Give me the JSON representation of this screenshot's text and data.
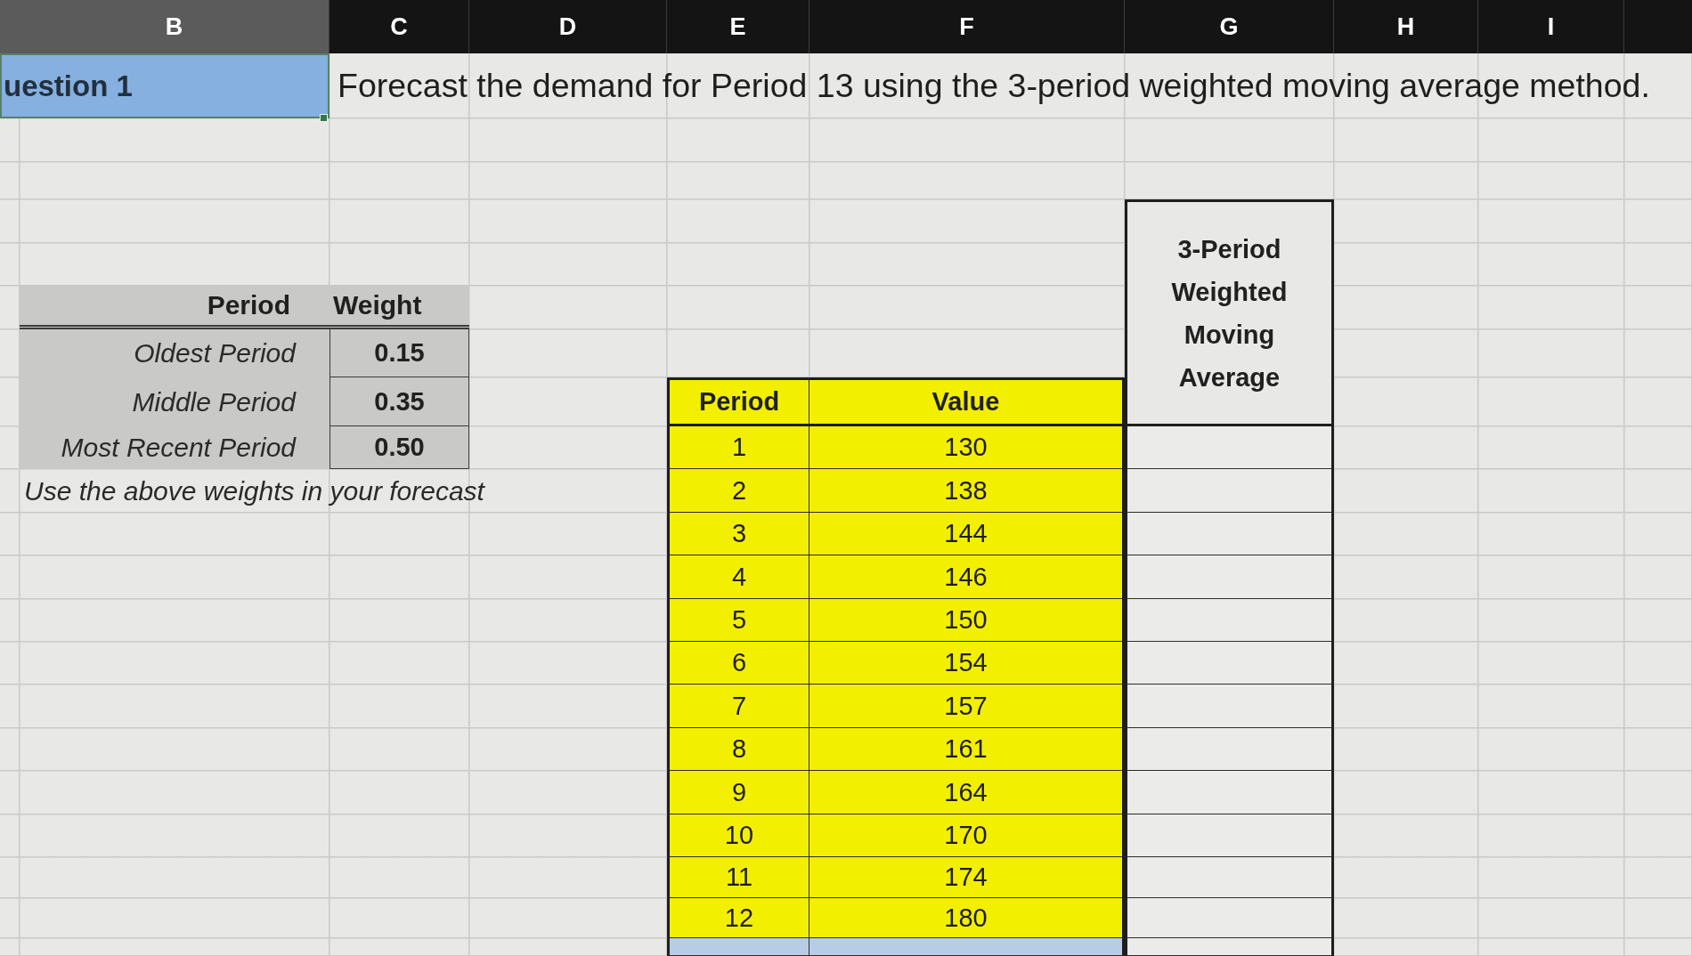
{
  "columns": [
    {
      "label": "B",
      "selected": true
    },
    {
      "label": "C",
      "selected": false
    },
    {
      "label": "D",
      "selected": false
    },
    {
      "label": "E",
      "selected": false
    },
    {
      "label": "F",
      "selected": false
    },
    {
      "label": "G",
      "selected": false
    },
    {
      "label": "H",
      "selected": false
    },
    {
      "label": "I",
      "selected": false
    }
  ],
  "question": {
    "label": "uestion 1",
    "selected": true,
    "text": "Forecast the demand for Period 13 using the 3-period weighted moving average method."
  },
  "weights_table": {
    "columns": [
      "Period",
      "Weight"
    ],
    "rows": [
      {
        "period": "Oldest Period",
        "weight": "0.15"
      },
      {
        "period": "Middle Period",
        "weight": "0.35"
      },
      {
        "period": "Most Recent Period",
        "weight": "0.50"
      }
    ],
    "note": "Use the above weights in your forecast"
  },
  "data_table": {
    "columns": [
      "Period",
      "Value"
    ],
    "rows": [
      {
        "period": "1",
        "value": "130",
        "selected": false
      },
      {
        "period": "2",
        "value": "138",
        "selected": false
      },
      {
        "period": "3",
        "value": "144",
        "selected": false
      },
      {
        "period": "4",
        "value": "146",
        "selected": false
      },
      {
        "period": "5",
        "value": "150",
        "selected": false
      },
      {
        "period": "6",
        "value": "154",
        "selected": false
      },
      {
        "period": "7",
        "value": "157",
        "selected": false
      },
      {
        "period": "8",
        "value": "161",
        "selected": false
      },
      {
        "period": "9",
        "value": "164",
        "selected": false
      },
      {
        "period": "10",
        "value": "170",
        "selected": false
      },
      {
        "period": "11",
        "value": "174",
        "selected": false
      },
      {
        "period": "12",
        "value": "180",
        "selected": false
      },
      {
        "selected": true
      }
    ]
  },
  "forecast_column": {
    "heading": "3-Period Weighted Moving Average"
  }
}
